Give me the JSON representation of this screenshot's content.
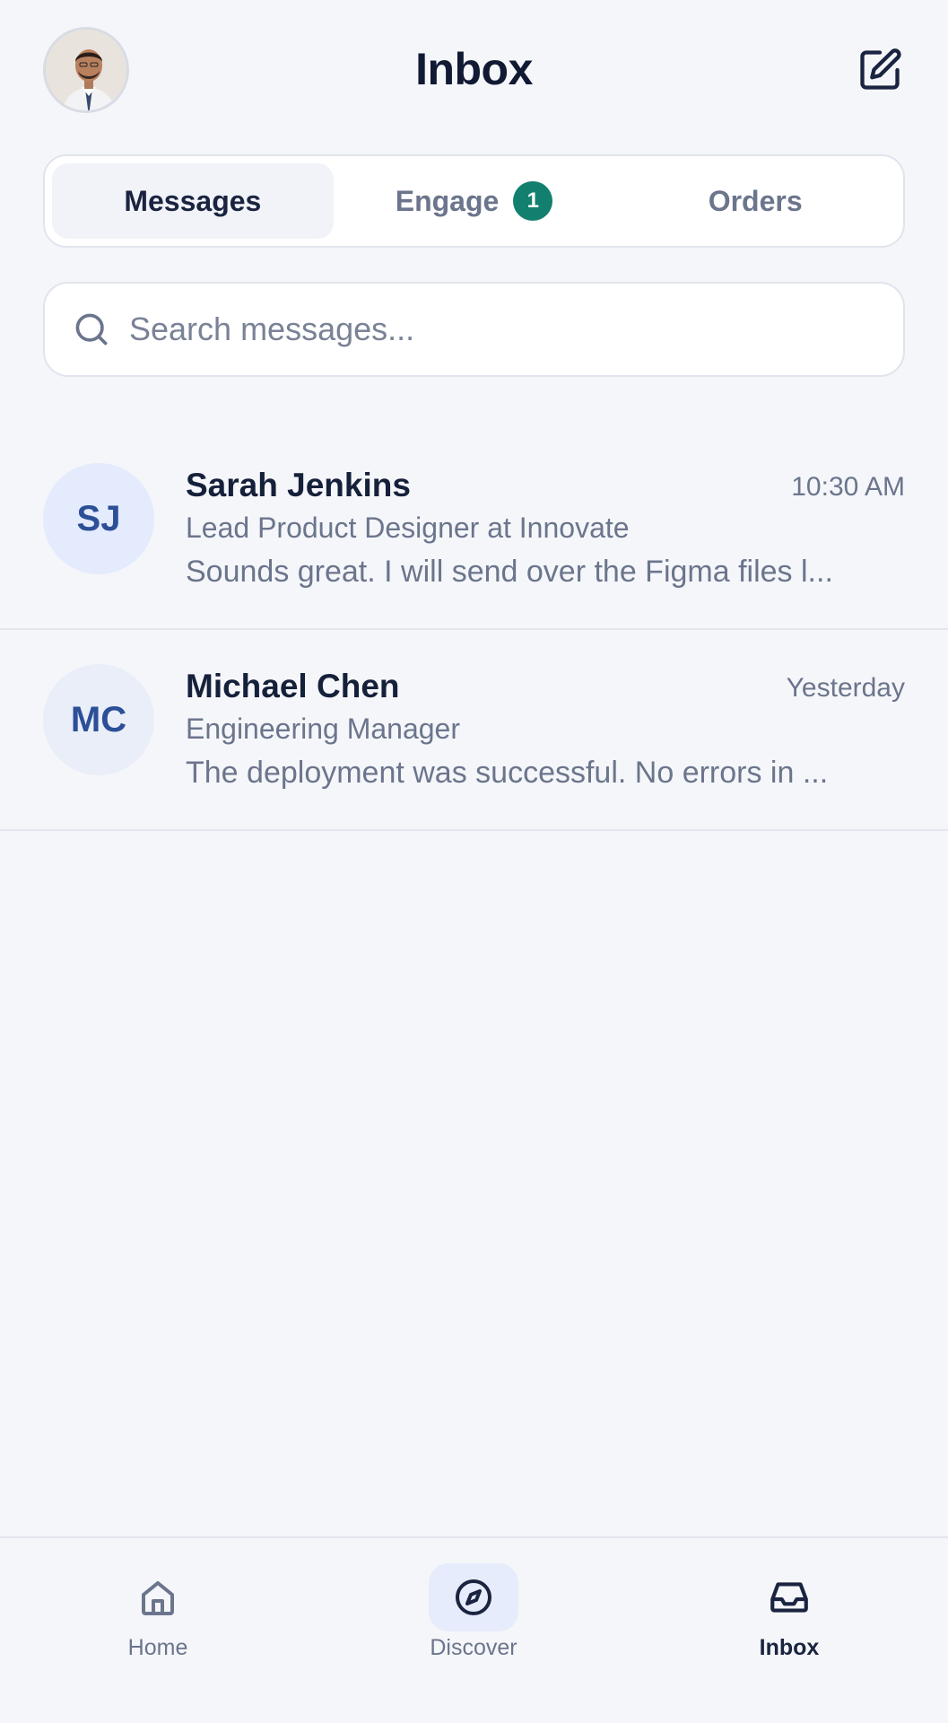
{
  "header": {
    "title": "Inbox",
    "profile_icon": "user-avatar-photo",
    "compose_icon": "edit-icon"
  },
  "tabs": [
    {
      "label": "Messages",
      "active": true
    },
    {
      "label": "Engage",
      "badge": "1",
      "active": false
    },
    {
      "label": "Orders",
      "active": false
    }
  ],
  "search": {
    "placeholder": "Search messages...",
    "value": "",
    "icon": "search-icon"
  },
  "conversations": [
    {
      "initials": "SJ",
      "name": "Sarah Jenkins",
      "time": "10:30 AM",
      "role": "Lead Product Designer at Innovate",
      "preview": "Sounds great. I will send over the Figma files l...",
      "avatar_bg": "#e3ebfc"
    },
    {
      "initials": "MC",
      "name": "Michael Chen",
      "time": "Yesterday",
      "role": "Engineering Manager",
      "preview": "The deployment was successful. No errors in ...",
      "avatar_bg": "#e9eef8"
    }
  ],
  "bottom_nav": [
    {
      "label": "Home",
      "icon": "home-icon",
      "active": false
    },
    {
      "label": "Discover",
      "icon": "compass-icon",
      "active": false
    },
    {
      "label": "Inbox",
      "icon": "inbox-icon",
      "active": true
    }
  ],
  "colors": {
    "background": "#f5f6fa",
    "badge": "#13806f",
    "avatar_text": "#2c4f97",
    "primary_text": "#111a33",
    "secondary_text": "#6b758c"
  }
}
